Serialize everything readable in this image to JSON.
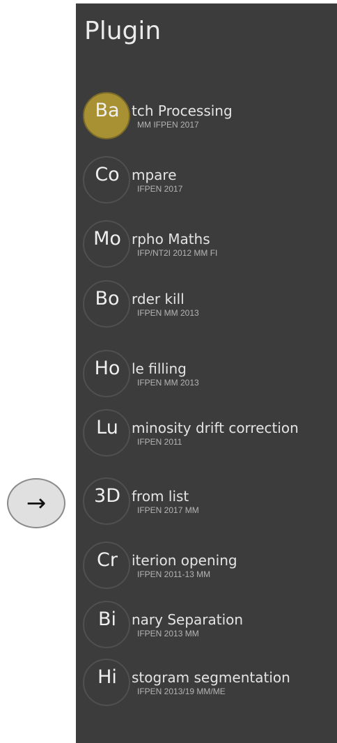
{
  "nav": {
    "arrow_icon": "right-arrow-icon",
    "arrow_label": "→"
  },
  "panel": {
    "title": "Plugin",
    "colors": {
      "background": "#3c3c3c",
      "active_accent": "#a89133"
    },
    "items": [
      {
        "abbr": "Ba",
        "rest": "tch Processing",
        "sub": "MM IFPEN 2017",
        "active": true
      },
      {
        "abbr": "Co",
        "rest": "mpare",
        "sub": "IFPEN 2017",
        "active": false
      },
      {
        "abbr": "Mo",
        "rest": "rpho Maths",
        "sub": "IFP/NT2I 2012 MM FI",
        "active": false
      },
      {
        "abbr": "Bo",
        "rest": "rder kill",
        "sub": "IFPEN MM 2013",
        "active": false
      },
      {
        "abbr": "Ho",
        "rest": "le filling",
        "sub": "IFPEN MM 2013",
        "active": false
      },
      {
        "abbr": "Lu",
        "rest": "minosity drift correction",
        "sub": "IFPEN 2011",
        "active": false
      },
      {
        "abbr": "3D",
        "rest": "from list",
        "sub": "IFPEN 2017 MM",
        "active": false
      },
      {
        "abbr": "Cr",
        "rest": "iterion opening",
        "sub": "IFPEN 2011-13 MM",
        "active": false
      },
      {
        "abbr": "Bi",
        "rest": "nary Separation",
        "sub": "IFPEN 2013 MM",
        "active": false
      },
      {
        "abbr": "Hi",
        "rest": "stogram segmentation",
        "sub": "IFPEN 2013/19 MM/ME",
        "active": false
      }
    ]
  }
}
